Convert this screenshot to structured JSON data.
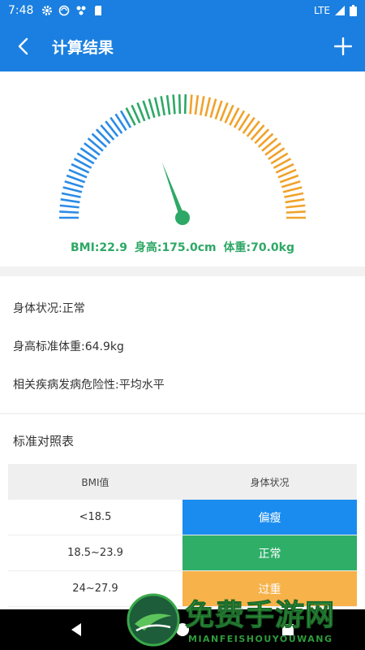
{
  "status_bar": {
    "time": "7:48",
    "network": "LTE",
    "icons": [
      "gear-icon",
      "sync-icon",
      "fan-icon",
      "sd-card-icon",
      "signal-icon",
      "battery-icon"
    ]
  },
  "app_bar": {
    "title": "计算结果",
    "back_icon": "back-arrow-icon",
    "add_icon": "plus-icon"
  },
  "gauge": {
    "bmi_label": "BMI:22.9",
    "height_label": "身高:175.0cm",
    "weight_label": "体重:70.0kg",
    "bmi_value": 22.9,
    "colors": {
      "low": "#2b8be6",
      "normal": "#2ea866",
      "high": "#f0a22b",
      "needle": "#2ea866"
    }
  },
  "info": {
    "body_status": "身体状况:正常",
    "standard_weight": "身高标准体重:64.9kg",
    "risk": "相关疾病发病危险性:平均水平"
  },
  "standard_table": {
    "title": "标准对照表",
    "headers": [
      "BMI值",
      "身体状况"
    ],
    "rows": [
      {
        "bmi": "<18.5",
        "status": "偏瘦",
        "color": "#1a8cf0"
      },
      {
        "bmi": "18.5~23.9",
        "status": "正常",
        "color": "#2fae68"
      },
      {
        "bmi": "24~27.9",
        "status": "过重",
        "color": "#f7b24a"
      }
    ]
  },
  "watermark": {
    "text": "免费手游网",
    "sub": "MIANFEISHOUYOUWANG"
  },
  "nav_bar": {
    "icons": [
      "back-triangle-icon",
      "home-circle-icon",
      "recents-square-icon"
    ]
  }
}
